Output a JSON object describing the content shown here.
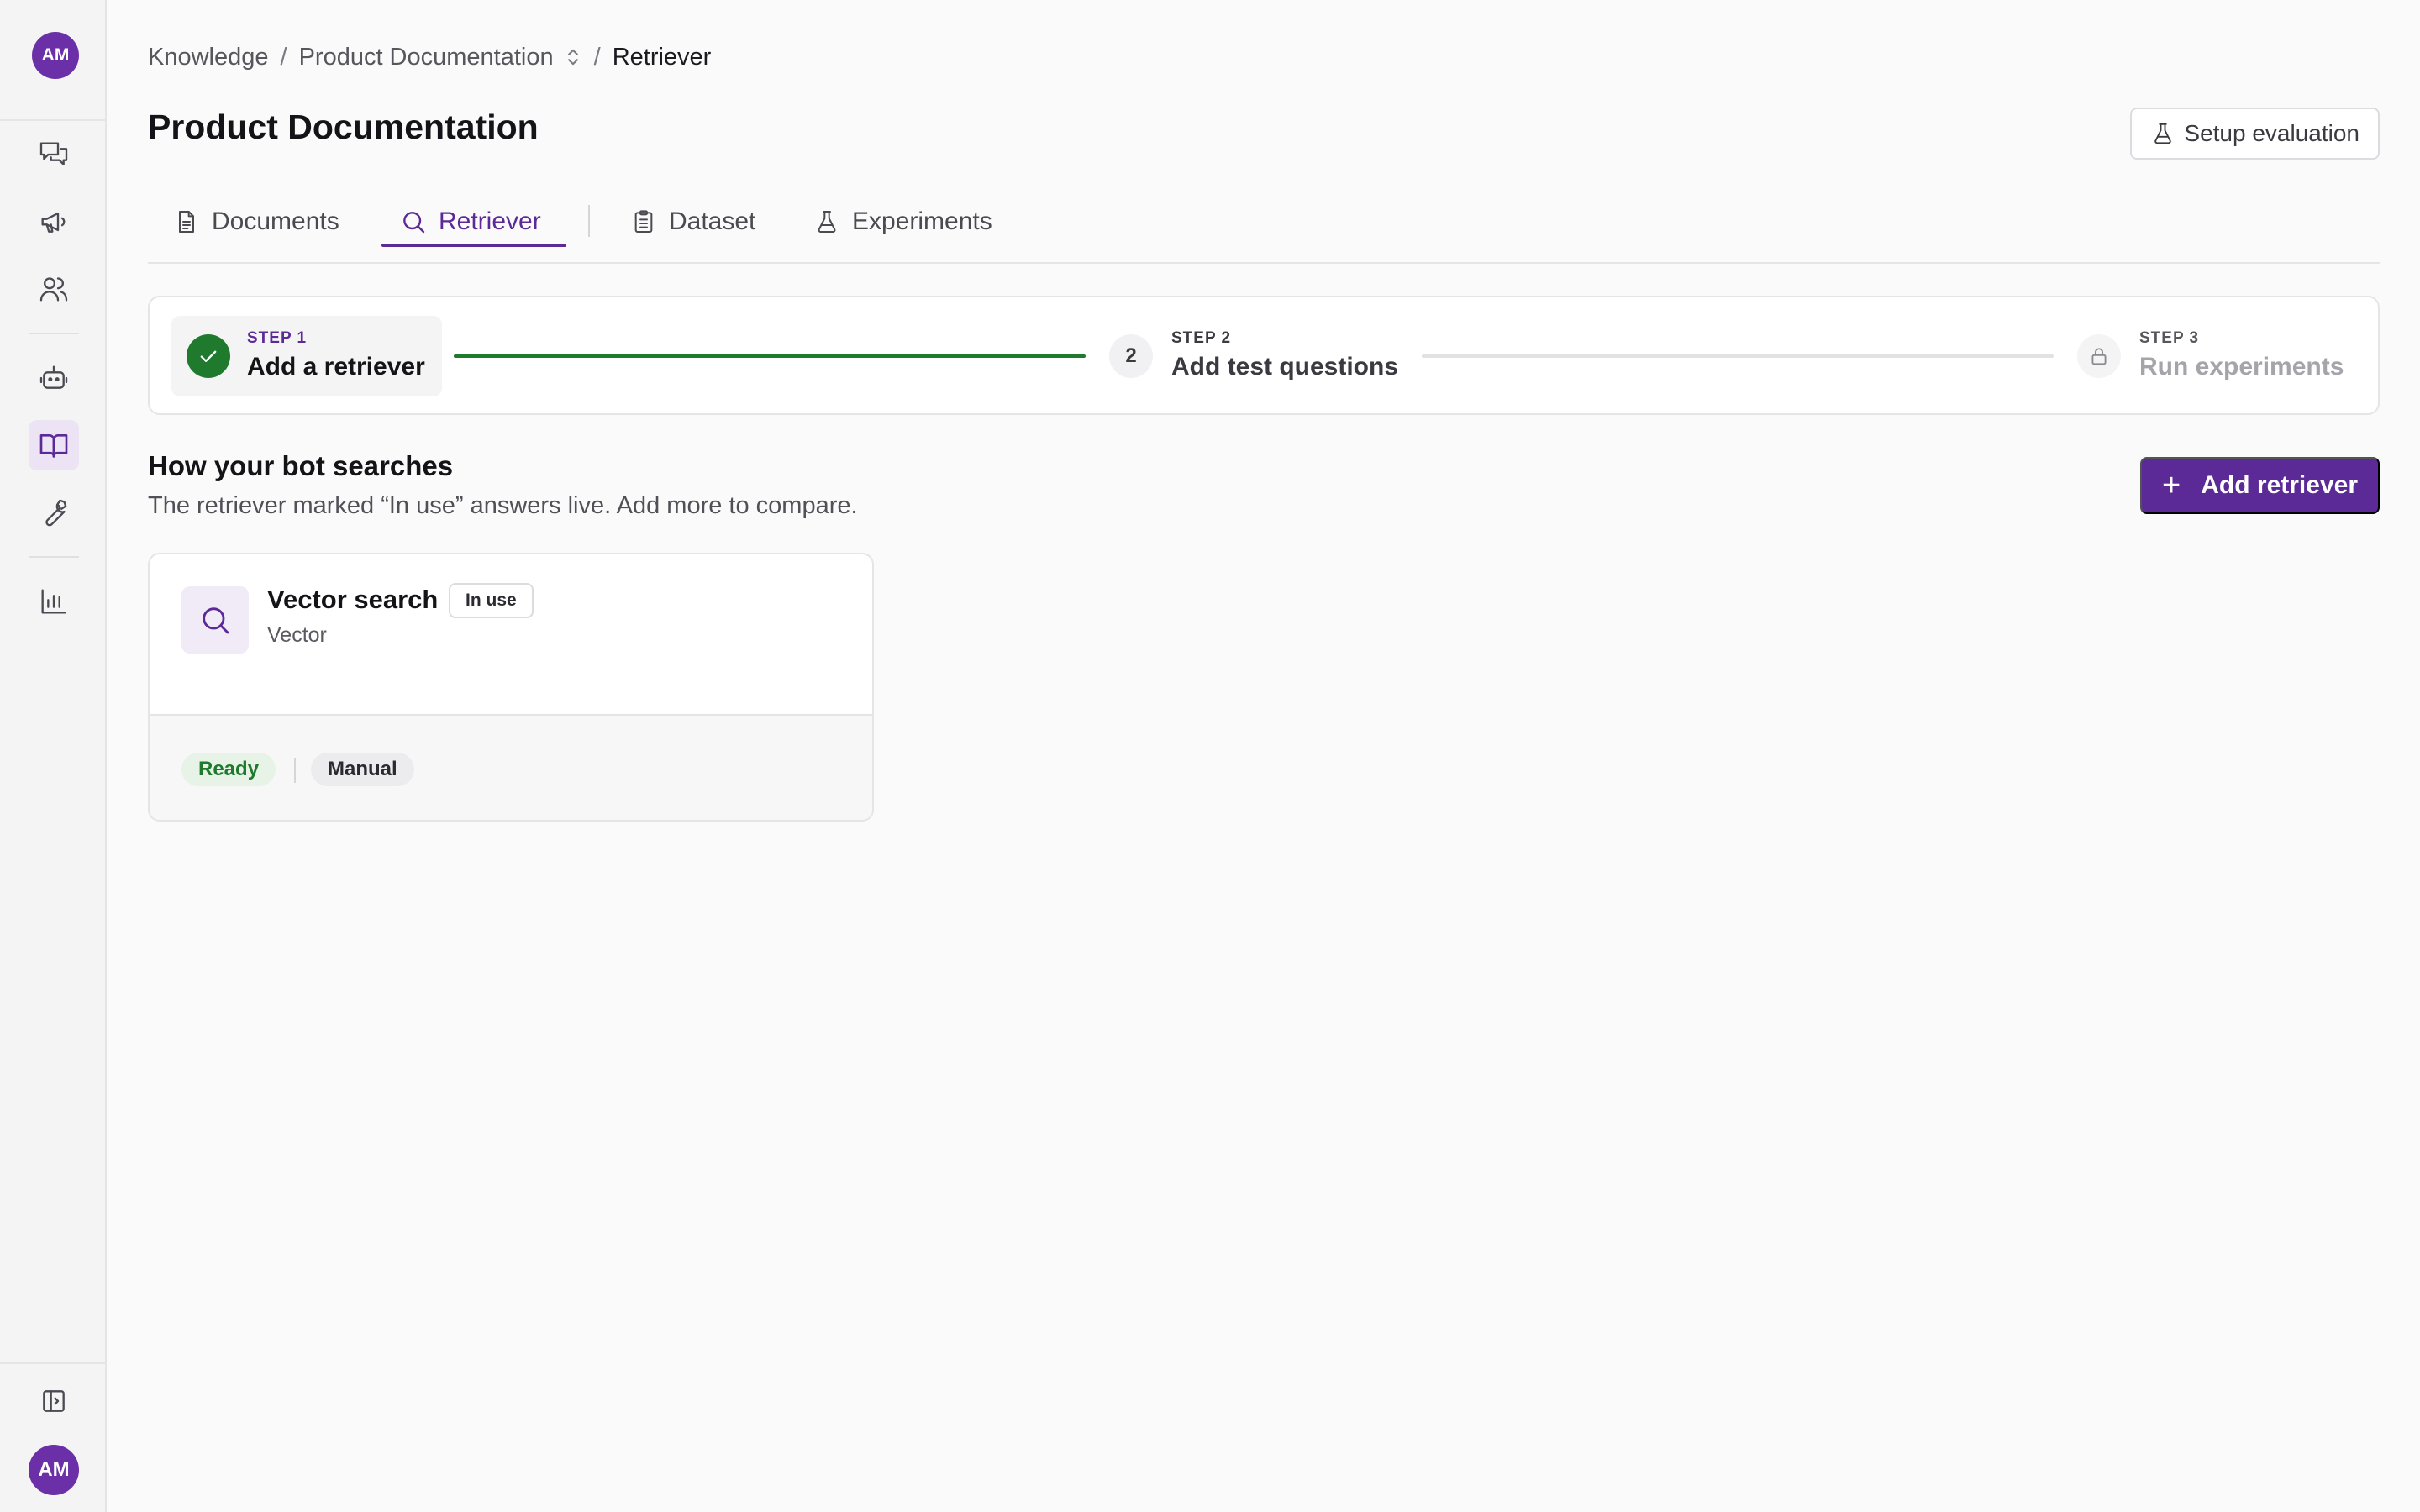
{
  "user": {
    "initials": "AM"
  },
  "breadcrumb": {
    "items": [
      "Knowledge",
      "Product Documentation",
      "Retriever"
    ],
    "separator": "/"
  },
  "page": {
    "title": "Product Documentation"
  },
  "header": {
    "setup_label": "Setup evaluation"
  },
  "tabs": [
    {
      "label": "Documents",
      "icon": "document-icon"
    },
    {
      "label": "Retriever",
      "icon": "search-icon",
      "active": true
    },
    {
      "label": "Dataset",
      "icon": "clipboard-icon"
    },
    {
      "label": "Experiments",
      "icon": "flask-icon"
    }
  ],
  "stepper": {
    "steps": [
      {
        "kicker": "STEP 1",
        "label": "Add a retriever",
        "status": "complete"
      },
      {
        "kicker": "STEP 2",
        "number": "2",
        "label": "Add test questions",
        "status": "current"
      },
      {
        "kicker": "STEP 3",
        "label": "Run experiments",
        "status": "locked"
      }
    ]
  },
  "section": {
    "title": "How your bot searches",
    "subtitle": "The retriever marked “In use” answers live. Add more to compare.",
    "add_label": "Add retriever"
  },
  "retrievers": [
    {
      "name": "Vector search",
      "badge": "In use",
      "type": "Vector",
      "status": "Ready",
      "mode": "Manual"
    }
  ],
  "colors": {
    "accent": "#5c2a97",
    "success": "#1f7a2e",
    "avatar": "#6b2fa8"
  }
}
